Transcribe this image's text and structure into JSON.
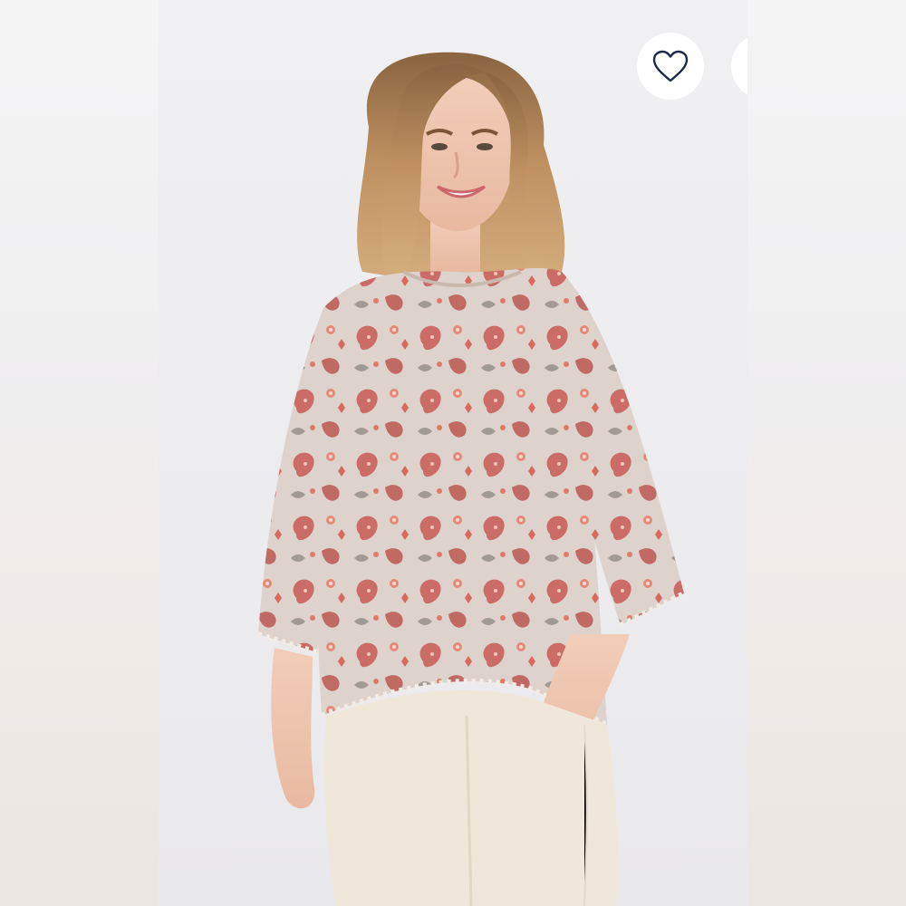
{
  "gallery": {
    "favorite_icon": "heart-outline-icon",
    "favorite_color": "#1b2a4a",
    "background_color": "#eeeef0"
  },
  "product_photo": {
    "blouse_color": "#ddd3cc",
    "print_accent_color": "#c85a55",
    "pants_color": "#efe7da",
    "hair_color": "#b98a55"
  }
}
